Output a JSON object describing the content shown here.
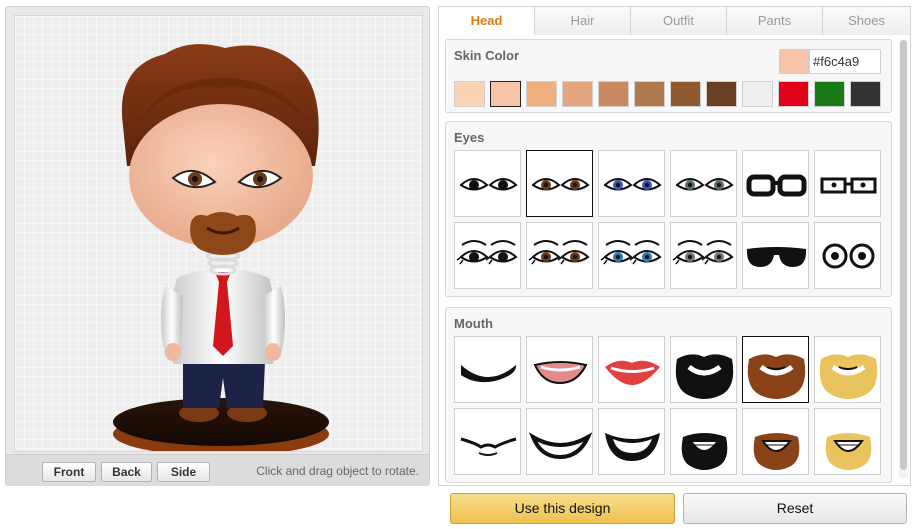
{
  "preview": {
    "buttons": {
      "front": "Front",
      "back": "Back",
      "side": "Side"
    },
    "hint": "Click and drag object to rotate."
  },
  "tabs": [
    {
      "label": "Head",
      "active": true
    },
    {
      "label": "Hair",
      "active": false
    },
    {
      "label": "Outfit",
      "active": false
    },
    {
      "label": "Pants",
      "active": false
    },
    {
      "label": "Shoes",
      "active": false
    }
  ],
  "skin": {
    "title": "Skin Color",
    "hex_value": "#f6c4a9",
    "swatches": [
      "#fbd4b6",
      "#f6c4a9",
      "#eeb07f",
      "#e3a67f",
      "#c98a63",
      "#b07a4f",
      "#8f5a30",
      "#6b3e26",
      "#efefef",
      "#e1001a",
      "#1a7a16",
      "#333333"
    ],
    "selected_index": 1
  },
  "eyes": {
    "title": "Eyes",
    "options": [
      "eyes-black-basic-icon",
      "eyes-brown-basic-icon",
      "eyes-blue-basic-icon",
      "eyes-grey-basic-icon",
      "glasses-thick-frame-icon",
      "glasses-rectangular-icon",
      "eyes-black-lashes-icon",
      "eyes-brown-lashes-icon",
      "eyes-blue-lashes-icon",
      "eyes-grey-lashes-icon",
      "sunglasses-icon",
      "eyes-cartoon-round-icon"
    ],
    "selected_index": 1
  },
  "mouth": {
    "title": "Mouth",
    "options": [
      "mouth-closed-smile-icon",
      "mouth-lips-teeth-icon",
      "mouth-red-lips-icon",
      "beard-black-full-icon",
      "beard-brown-full-icon",
      "beard-blonde-full-icon",
      "mouth-thin-smirk-icon",
      "mouth-open-smile-icon",
      "mouth-toothy-grin-icon",
      "goatee-black-grin-icon",
      "goatee-brown-grin-icon",
      "goatee-blonde-grin-icon"
    ],
    "selected_index": 4
  },
  "actions": {
    "use": "Use this design",
    "reset": "Reset"
  },
  "colors": {
    "accent_tab": "#e47911",
    "use_button": "#f0c14b"
  }
}
